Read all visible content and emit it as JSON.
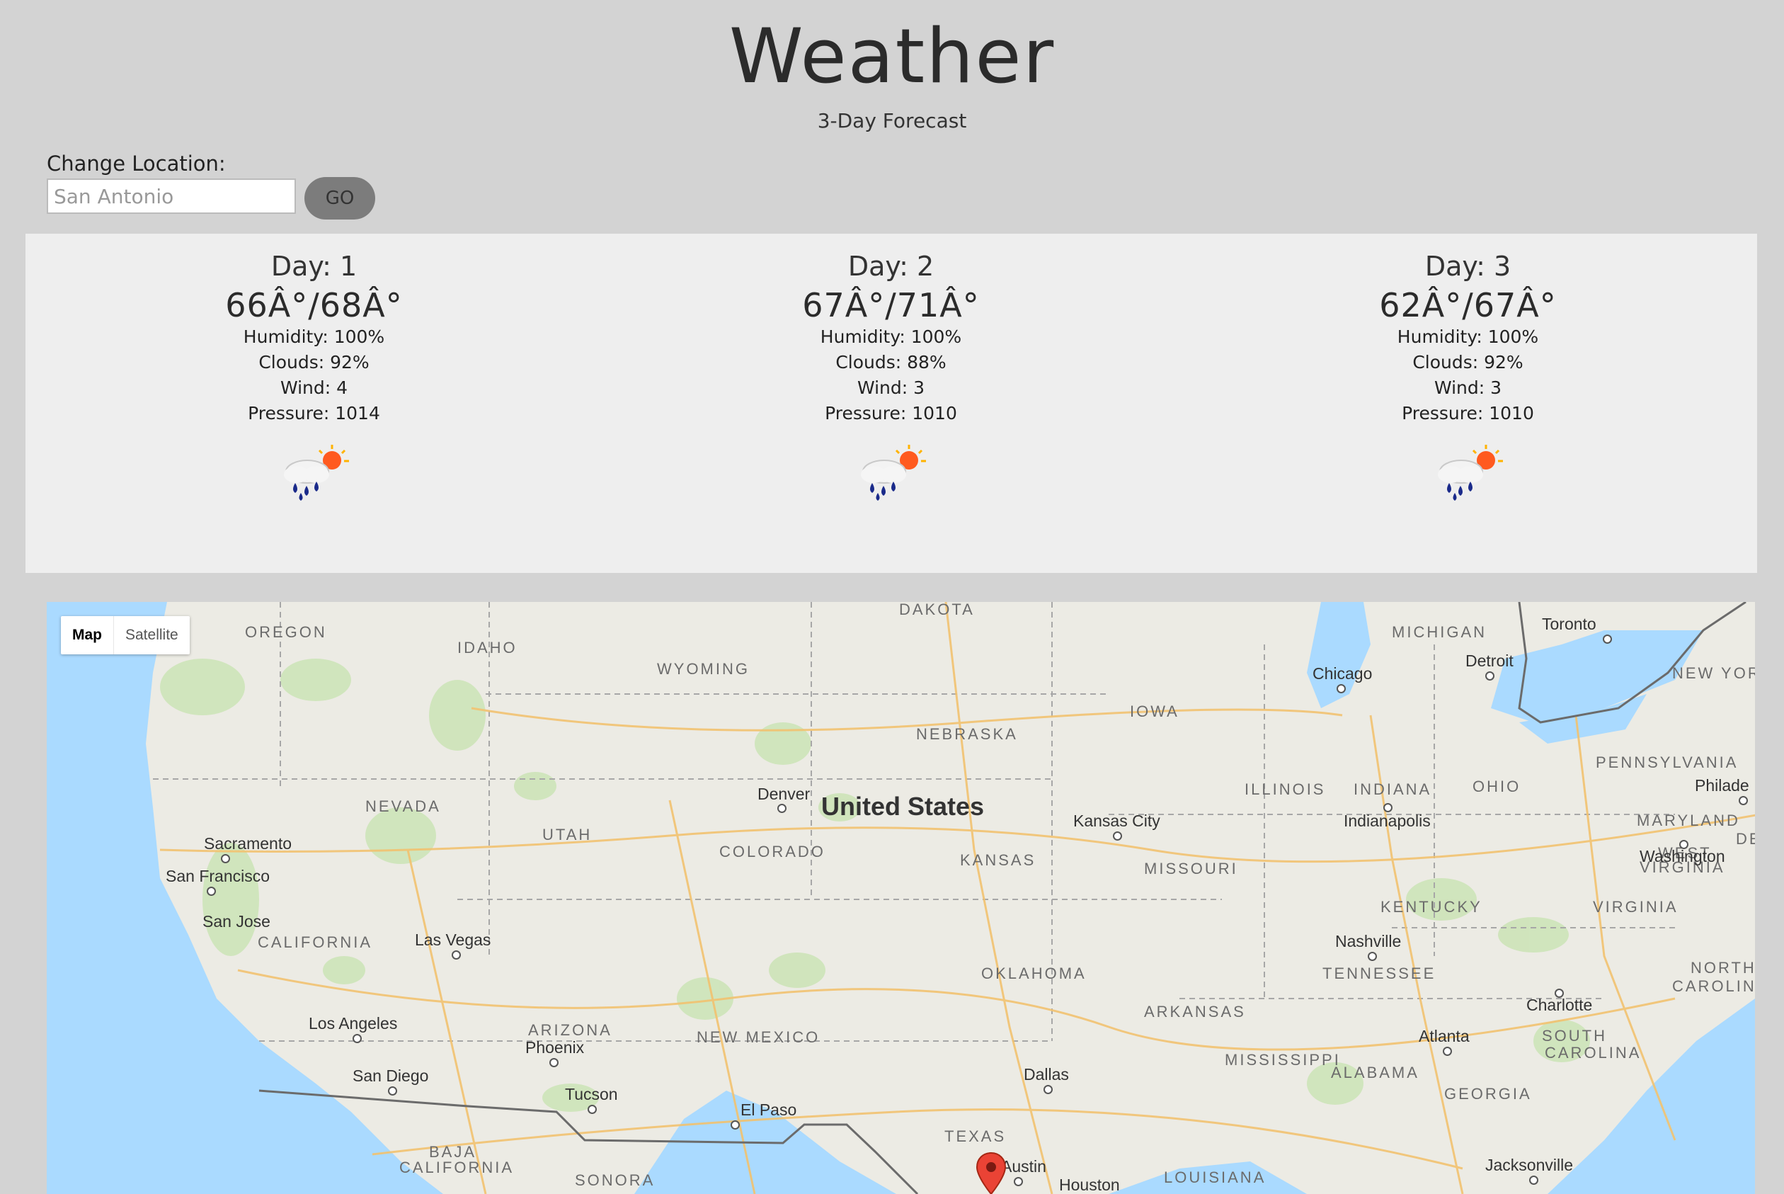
{
  "header": {
    "title": "Weather",
    "subtitle": "3-Day Forecast"
  },
  "location": {
    "label": "Change Location:",
    "placeholder": "San Antonio",
    "go_label": "GO"
  },
  "days": [
    {
      "label": "Day: 1",
      "temp": "66Â°/68Â°",
      "humidity": "Humidity: 100%",
      "clouds": "Clouds: 92%",
      "wind": "Wind: 4",
      "pressure": "Pressure: 1014",
      "icon": "rain-cloud-sun-icon"
    },
    {
      "label": "Day: 2",
      "temp": "67Â°/71Â°",
      "humidity": "Humidity: 100%",
      "clouds": "Clouds: 88%",
      "wind": "Wind: 3",
      "pressure": "Pressure: 1010",
      "icon": "rain-cloud-sun-icon"
    },
    {
      "label": "Day: 3",
      "temp": "62Â°/67Â°",
      "humidity": "Humidity: 100%",
      "clouds": "Clouds: 92%",
      "wind": "Wind: 3",
      "pressure": "Pressure: 1010",
      "icon": "rain-cloud-sun-icon"
    }
  ],
  "map": {
    "map_label": "Map",
    "satellite_label": "Satellite",
    "country": "United States",
    "states": [
      "DAKOTA",
      "OREGON",
      "IDAHO",
      "WYOMING",
      "MICHIGAN",
      "NEW YORK",
      "IOWA",
      "NEBRASKA",
      "PENNSYLVANIA",
      "NEVADA",
      "UTAH",
      "COLORADO",
      "KANSAS",
      "ILLINOIS",
      "INDIANA",
      "OHIO",
      "MARYLAND",
      "DE",
      "WEST",
      "VIRGINIA",
      "MISSOURI",
      "KENTUCKY",
      "VIRGINIA",
      "CALIFORNIA",
      "OKLAHOMA",
      "TENNESSEE",
      "NORTH",
      "CAROLINA",
      "ARKANSAS",
      "ARIZONA",
      "NEW MEXICO",
      "MISSISSIPPI",
      "ALABAMA",
      "SOUTH",
      "CAROLINA",
      "GEORGIA",
      "TEXAS",
      "LOUISIANA",
      "BAJA",
      "CALIFORNIA",
      "SONORA"
    ],
    "cities": [
      "Toronto",
      "Detroit",
      "Chicago",
      "Denver",
      "Kansas City",
      "Philade",
      "Indianapolis",
      "Washington",
      "Sacramento",
      "San Francisco",
      "San Jose",
      "Las Vegas",
      "Nashville",
      "Charlotte",
      "Los Angeles",
      "Phoenix",
      "Atlanta",
      "San Diego",
      "Dallas",
      "Tucson",
      "El Paso",
      "Austin",
      "Houston",
      "Jacksonville"
    ],
    "marker_icon": "map-pin-icon"
  }
}
